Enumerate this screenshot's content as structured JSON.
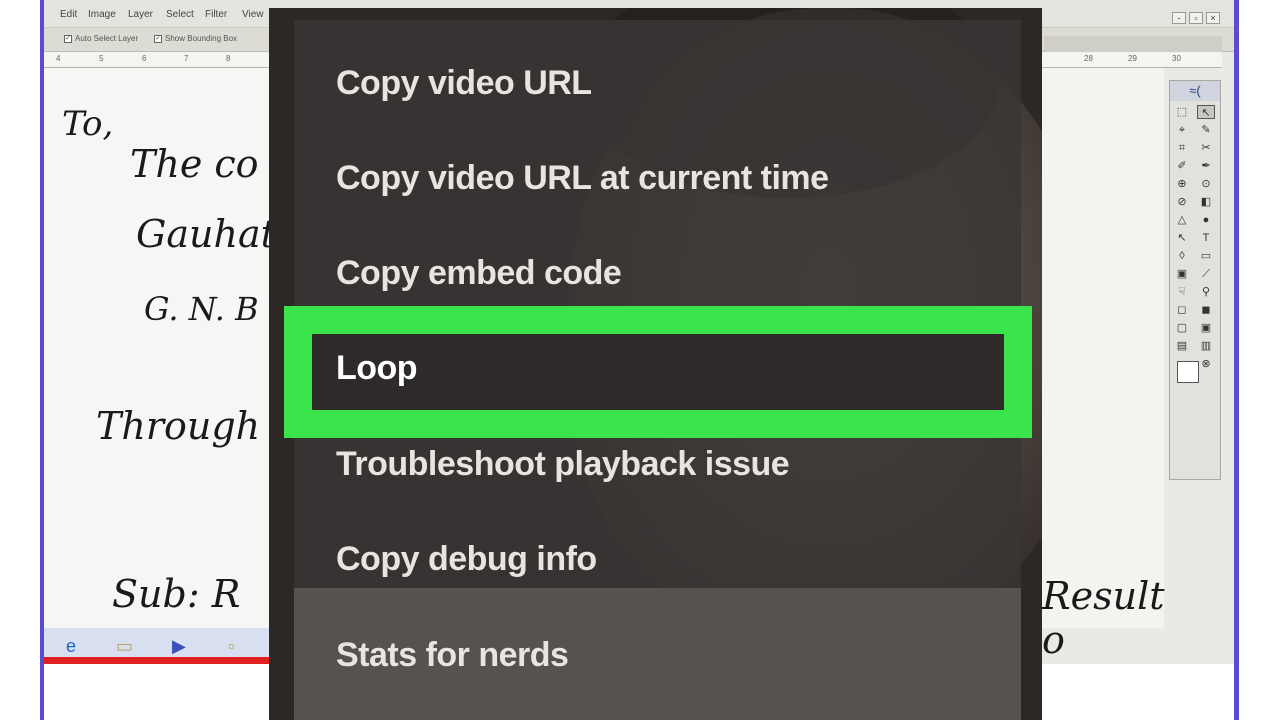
{
  "editor": {
    "menu": [
      "Edit",
      "Image",
      "Layer",
      "Select",
      "Filter",
      "View"
    ],
    "options": [
      {
        "label": "Auto Select Layer",
        "checked": true
      },
      {
        "label": "Show Bounding Box",
        "checked": true
      }
    ],
    "ruler_left": [
      "4",
      "5",
      "6",
      "7",
      "8"
    ],
    "ruler_right": [
      "28",
      "29",
      "30"
    ],
    "window_buttons": [
      "-",
      "▫",
      "×"
    ],
    "handwriting_left": [
      "To,",
      "The co",
      "Gauhat",
      "G. N. B",
      "Through",
      "Sub: R"
    ],
    "handwriting_right": "Result o",
    "toolbox_header": "≈(",
    "tools": [
      "⬚",
      "↖",
      "⌖",
      "✎",
      "⌗",
      "✂",
      "✐",
      "✒",
      "⊕",
      "⊙",
      "⊘",
      "◧",
      "△",
      "●",
      "↖",
      "T",
      "◊",
      "▭",
      "▣",
      "⟋",
      "☟",
      "⚲",
      "◻",
      "◼",
      "▢",
      "▣",
      "▤",
      "▥",
      "⇥",
      "⊗"
    ]
  },
  "taskbar": {
    "icons": [
      "e",
      "▭",
      "▶",
      "▫"
    ]
  },
  "context_menu": {
    "items": [
      {
        "label": "Copy video URL",
        "selected": false
      },
      {
        "label": "Copy video URL at current time",
        "selected": false
      },
      {
        "label": "Copy embed code",
        "selected": false
      },
      {
        "label": "Loop",
        "selected": true
      },
      {
        "label": "Troubleshoot playback issue",
        "selected": false
      },
      {
        "label": "Copy debug info",
        "selected": false
      },
      {
        "label": "Stats for nerds",
        "selected": false
      }
    ],
    "highlight_color": "#3ce44c"
  }
}
